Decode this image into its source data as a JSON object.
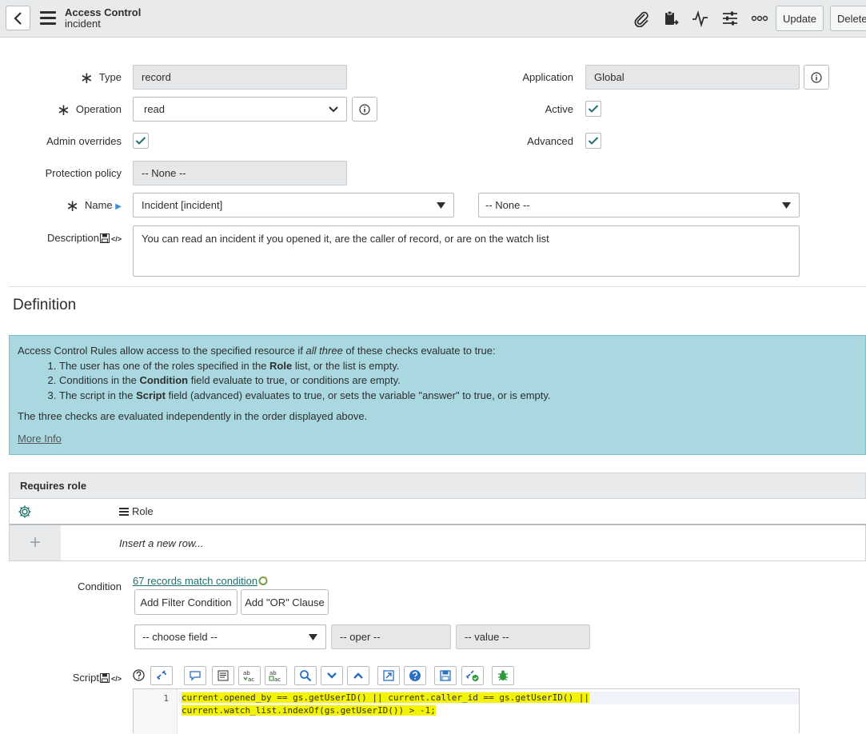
{
  "header": {
    "title": "Access Control",
    "subtitle": "incident",
    "update_label": "Update",
    "delete_label": "Delete"
  },
  "form": {
    "type_label": "Type",
    "type_value": "record",
    "operation_label": "Operation",
    "operation_value": "read",
    "admin_overrides_label": "Admin overrides",
    "protection_policy_label": "Protection policy",
    "protection_policy_value": "-- None --",
    "name_label": "Name",
    "name_table_value": "Incident [incident]",
    "name_field_value": "-- None --",
    "description_label": "Description",
    "description_value": "You can read an incident if you opened it, are the caller of record, or are on the watch list",
    "application_label": "Application",
    "application_value": "Global",
    "active_label": "Active",
    "advanced_label": "Advanced"
  },
  "definition": {
    "title": "Definition",
    "intro_pre": "Access Control Rules allow access to the specified resource if ",
    "intro_em": "all three",
    "intro_post": " of these checks evaluate to true:",
    "item1_pre": "The user has one of the roles specified in the ",
    "item1_bold": "Role",
    "item1_post": " list, or the list is empty.",
    "item2_pre": "Conditions in the ",
    "item2_bold": "Condition",
    "item2_post": " field evaluate to true, or conditions are empty.",
    "item3_pre": "The script in the ",
    "item3_bold": "Script",
    "item3_post": " field (advanced) evaluates to true, or sets the variable \"answer\" to true, or is empty.",
    "note": "The three checks are evaluated independently in the order displayed above.",
    "more_info": "More Info"
  },
  "roles": {
    "header": "Requires role",
    "column": "Role",
    "insert_row": "Insert a new row..."
  },
  "condition": {
    "label": "Condition",
    "match_link": "67 records match condition",
    "add_filter": "Add Filter Condition",
    "add_or": "Add \"OR\" Clause",
    "field_placeholder": "-- choose field --",
    "oper_placeholder": "-- oper --",
    "value_placeholder": "-- value --"
  },
  "script": {
    "label": "Script",
    "line_number": "1",
    "line1": "current.opened_by == gs.getUserID() || current.caller_id == gs.getUserID() ||",
    "line2": "current.watch_list.indexOf(gs.getUserID()) > -1;"
  },
  "colors": {
    "header_bg": "#e8eaeb",
    "info_bg": "#a9d8e0",
    "check_color": "#1f6e6e",
    "highlight": "#f4f400"
  }
}
